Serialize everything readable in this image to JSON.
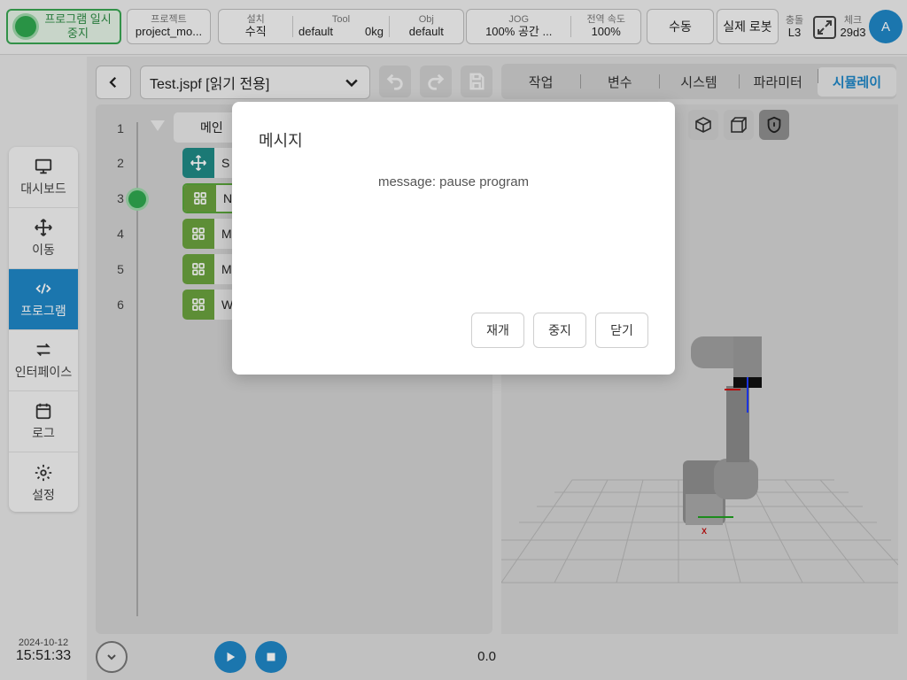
{
  "header": {
    "status": {
      "line1": "프로그램 일시",
      "line2": "중지",
      "color": "#2fa84f"
    },
    "project": {
      "label": "프로젝트",
      "value": "project_mo..."
    },
    "install": {
      "label": "설치",
      "value": "수직"
    },
    "tool": {
      "label": "Tool",
      "name": "default",
      "weight": "0kg"
    },
    "obj": {
      "label": "Obj",
      "value": "default"
    },
    "jog": {
      "label": "JOG",
      "value": "100%  공간 ..."
    },
    "speed": {
      "label": "전역 속도",
      "value": "100%"
    },
    "manual_label": "수동",
    "real_robot_label": "실제 로봇",
    "collision": {
      "label": "충돌",
      "value": "L3"
    },
    "check": {
      "label": "체크",
      "value": "29d3"
    },
    "avatar_letter": "A",
    "accent": "#1f87c7"
  },
  "sidebar": {
    "items": [
      {
        "label": "대시보드",
        "icon": "monitor-icon"
      },
      {
        "label": "이동",
        "icon": "move-icon"
      },
      {
        "label": "프로그램",
        "icon": "code-icon",
        "active": true
      },
      {
        "label": "인터페이스",
        "icon": "swap-icon"
      },
      {
        "label": "로그",
        "icon": "calendar-icon"
      },
      {
        "label": "설정",
        "icon": "gear-icon"
      }
    ]
  },
  "datetime": {
    "date": "2024-10-12",
    "time": "15:51:33"
  },
  "file": {
    "name": "Test.jspf [읽기 전용]"
  },
  "tabs": [
    {
      "label": "작업"
    },
    {
      "label": "변수"
    },
    {
      "label": "시스템"
    },
    {
      "label": "파라미터"
    },
    {
      "label": "시뮬레이",
      "active": true
    }
  ],
  "program": {
    "lines": [
      "1",
      "2",
      "3",
      "4",
      "5",
      "6"
    ],
    "nodes": [
      {
        "text": "메인"
      },
      {
        "text": "S"
      },
      {
        "text": "N"
      },
      {
        "text": "M"
      },
      {
        "text": "M"
      },
      {
        "text": "W"
      }
    ],
    "time_value": "0.0"
  },
  "modal": {
    "title": "메시지",
    "message": "message: pause program",
    "buttons": {
      "resume": "재개",
      "stop": "중지",
      "close": "닫기"
    }
  }
}
